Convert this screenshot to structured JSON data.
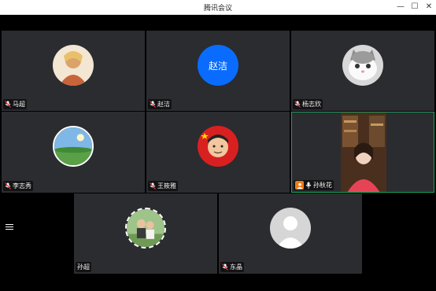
{
  "window": {
    "title": "腾讯会议",
    "minimize_glyph": "—",
    "maximize_glyph": "☐",
    "close_glyph": "✕"
  },
  "colors": {
    "tile_bg": "#2a2c30",
    "active_border": "#1aa35c",
    "avatar_blue": "#0a6cff",
    "host_orange": "#f07b15"
  },
  "participants": [
    {
      "name": "马超",
      "avatar": "photo-portrait-icon",
      "muted": true
    },
    {
      "name": "赵洁",
      "avatar_text": "赵洁",
      "muted": true
    },
    {
      "name": "杨志欣",
      "avatar": "cat-photo-icon",
      "muted": true
    },
    {
      "name": "李志秀",
      "avatar": "landscape-photo-icon",
      "muted": true
    },
    {
      "name": "王筱雅",
      "avatar": "cartoon-boy-icon",
      "muted": true
    },
    {
      "name": "孙秋花",
      "avatar": "live-video",
      "muted": false,
      "host": true,
      "active": true
    },
    {
      "name": "孙超",
      "avatar": "couple-photo-icon",
      "muted": true
    },
    {
      "name": "东晶",
      "avatar": "default-user-icon",
      "muted": true
    }
  ],
  "sidebar": {
    "toggle_icon": "list-icon"
  }
}
